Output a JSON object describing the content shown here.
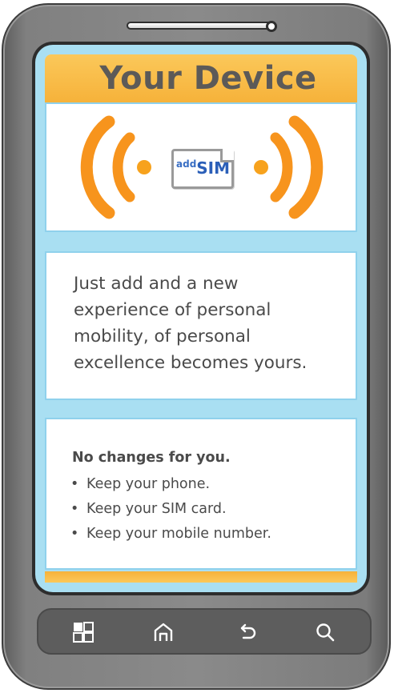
{
  "screen": {
    "header": {
      "title": "Your Device"
    },
    "signal_panel": {
      "sim_badge_prefix": "add",
      "sim_badge_main": "SIM",
      "wave_color": "#f7941d"
    },
    "description": {
      "lines": [
        "Just add and a new",
        "experience of personal",
        "mobility, of personal",
        "excellence becomes yours."
      ]
    },
    "benefits": {
      "title": "No changes for you.",
      "bullet": "•",
      "items": [
        "Keep your phone.",
        "Keep your SIM card.",
        "Keep your mobile number."
      ]
    }
  },
  "navbar": {
    "icons": [
      "apps-grid-icon",
      "home-icon",
      "back-icon",
      "search-icon"
    ]
  },
  "colors": {
    "header": "#f6b23a",
    "screen_bg": "#a9dff2",
    "phone_body": "#808080",
    "text": "#4a4a4a"
  }
}
